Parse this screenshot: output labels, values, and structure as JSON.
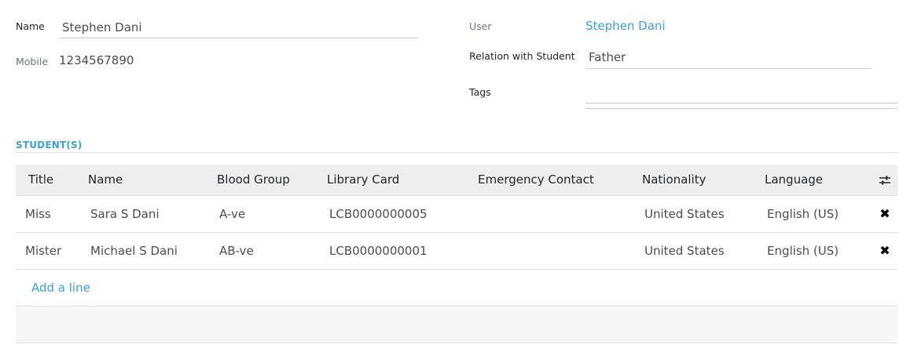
{
  "form": {
    "name_label": "Name",
    "name_value": "Stephen Dani",
    "mobile_label": "Mobile",
    "mobile_value": "1234567890",
    "user_label": "User",
    "user_value": "Stephen Dani",
    "relation_label": "Relation with Student",
    "relation_value": "Father",
    "tags_label": "Tags",
    "tags_value": ""
  },
  "students": {
    "section_title": "STUDENT(S)",
    "columns": [
      "Title",
      "Name",
      "Blood Group",
      "Library Card",
      "Emergency Contact",
      "Nationality",
      "Language"
    ],
    "rows": [
      {
        "title": "Miss",
        "name": "Sara S Dani",
        "blood_group": "A-ve",
        "library_card": "LCB0000000005",
        "emergency_contact": "",
        "nationality": "United States",
        "language": "English (US)"
      },
      {
        "title": "Mister",
        "name": "Michael S Dani",
        "blood_group": "AB-ve",
        "library_card": "LCB0000000001",
        "emergency_contact": "",
        "nationality": "United States",
        "language": "English (US)"
      }
    ],
    "add_line_label": "Add a line",
    "delete_icon": "✖",
    "optional_columns_icon": "sliders-icon"
  },
  "colors": {
    "accent": "#3aa0db",
    "header_bg": "#eeeeee",
    "border": "#dee2e6"
  }
}
